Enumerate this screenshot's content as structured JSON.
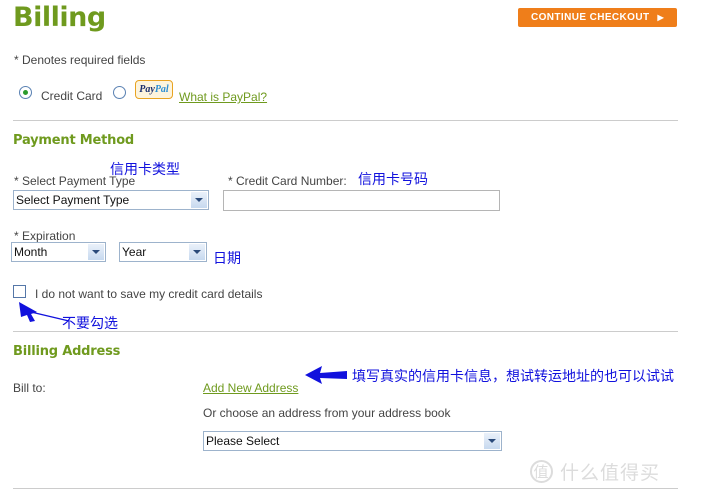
{
  "header": {
    "title": "Billing",
    "continue_button_label": "CONTINUE CHECKOUT",
    "continue_button_arrow": "▶",
    "required_note": "* Denotes required fields"
  },
  "payment_selector": {
    "credit_card_label": "Credit Card",
    "paypal_logo_pay": "Pay",
    "paypal_logo_pal": "Pal",
    "what_is_paypal_link": "What is PayPal?"
  },
  "payment_method": {
    "section_title": "Payment Method",
    "select_payment_type_label": "* Select Payment Type",
    "select_payment_type_value": "Select Payment Type",
    "credit_card_number_label": "* Credit Card Number:",
    "credit_card_number_value": "",
    "expiration_label": "* Expiration",
    "month_value": "Month",
    "year_value": "Year",
    "save_details_checkbox_label": "I do not want to save my credit card details",
    "save_details_checked": false
  },
  "billing_address": {
    "section_title": "Billing Address",
    "bill_to_label": "Bill to:",
    "add_new_address_link": "Add New Address",
    "or_choose_text": "Or choose an address from your address book",
    "address_select_value": "Please Select"
  },
  "annotations": {
    "card_type": "信用卡类型",
    "card_number": "信用卡号码",
    "expiry_date": "日期",
    "do_not_check": "不要勾选",
    "fill_real_info": "填写真实的信用卡信息，想试转运地址的也可以试试"
  },
  "watermark": {
    "circle_char": "值",
    "text": "什么值得买"
  },
  "colors": {
    "brand_green": "#6f9a1e",
    "accent_orange": "#ef7e1a",
    "annotation_blue": "#1111dd",
    "divider_grey": "#cccccc"
  }
}
